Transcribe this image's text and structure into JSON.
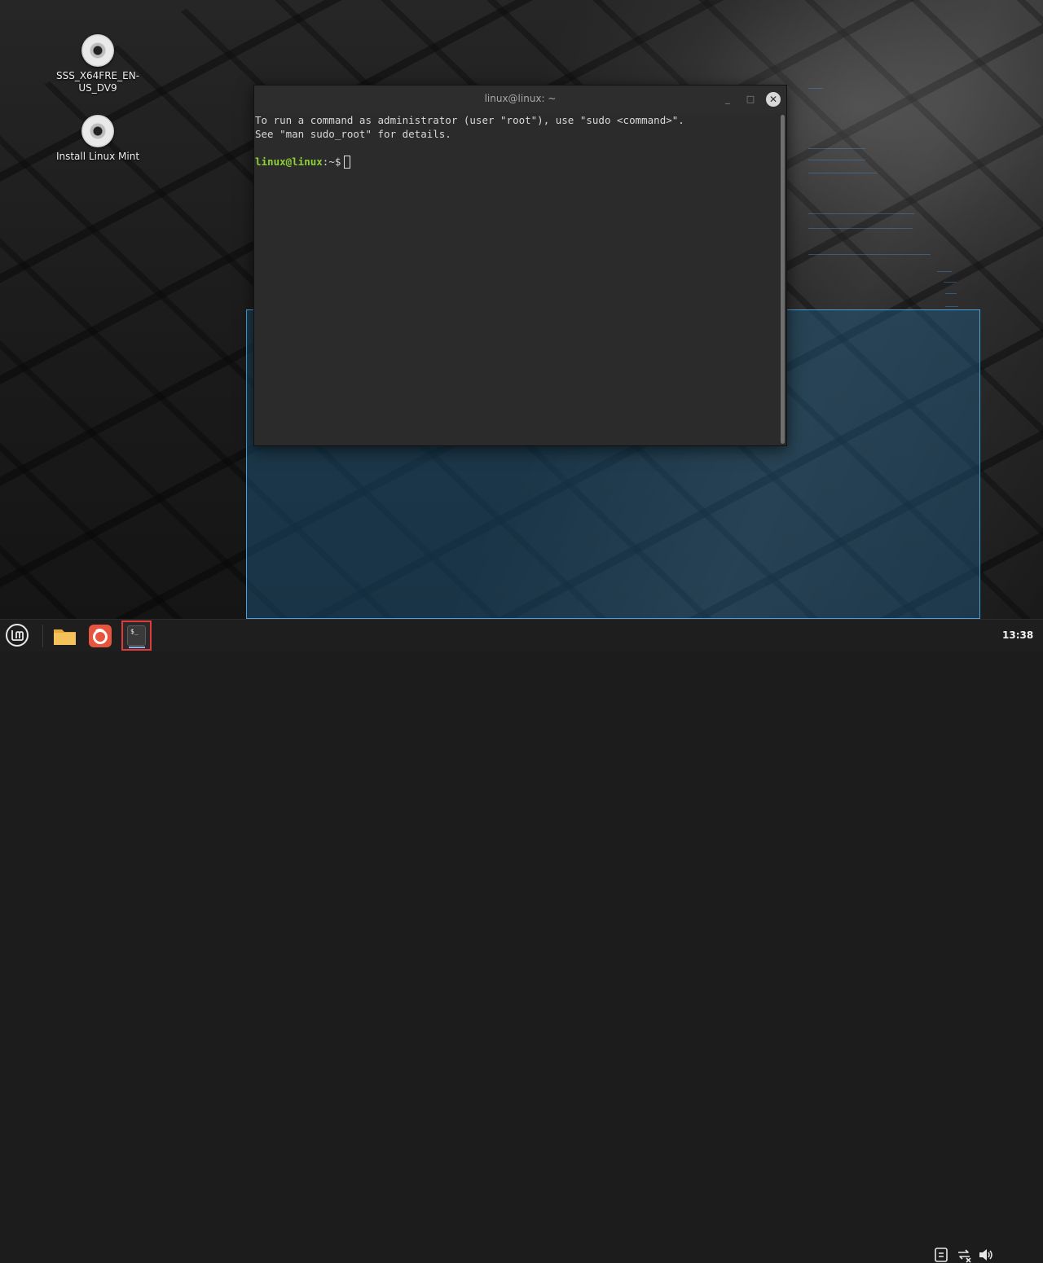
{
  "desktop": {
    "icons": [
      {
        "label": "SSS_X64FRE_EN-US_DV9",
        "icon": "disc-icon"
      },
      {
        "label": "Install Linux Mint",
        "icon": "disc-icon"
      }
    ]
  },
  "terminal": {
    "title": "linux@linux: ~",
    "lines": [
      "To run a command as administrator (user \"root\"), use \"sudo <command>\".",
      "See \"man sudo_root\" for details."
    ],
    "prompt_user": "linux@linux",
    "prompt_path": ":~$",
    "buttons": {
      "minimize": "_",
      "maximize": "□",
      "close": "✕"
    }
  },
  "taskbar": {
    "apps": [
      {
        "name": "Files",
        "icon": "folder-icon"
      },
      {
        "name": "Firefox",
        "icon": "firefox-icon"
      },
      {
        "name": "Terminal",
        "icon": "terminal-icon",
        "active": true
      }
    ],
    "tray": [
      "notes-icon",
      "network-disconnected-icon",
      "volume-icon"
    ],
    "clock": "13:38"
  },
  "colors": {
    "prompt_green": "#8ed038",
    "selection_border": "#4aa3d8",
    "active_task_border": "#e03a3a"
  }
}
